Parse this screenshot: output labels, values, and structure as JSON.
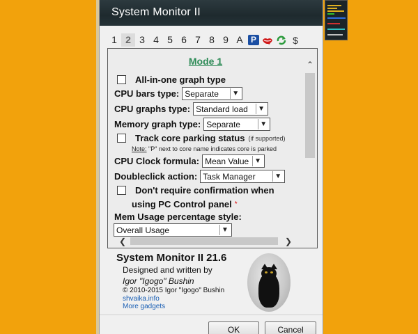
{
  "window": {
    "title": "System Monitor II"
  },
  "tabs": [
    "1",
    "2",
    "3",
    "4",
    "5",
    "6",
    "7",
    "8",
    "9",
    "A"
  ],
  "tab_icons": {
    "p_label": "P",
    "dollar_label": "$"
  },
  "panel": {
    "mode_title": "Mode 1",
    "all_in_one_label": "All-in-one graph type",
    "cpu_bars_label": "CPU bars type:",
    "cpu_bars_value": "Separate",
    "cpu_graphs_label": "CPU graphs type:",
    "cpu_graphs_value": "Standard load",
    "memory_graph_label": "Memory graph type:",
    "memory_graph_value": "Separate",
    "track_core_label": "Track core parking status",
    "track_core_hint": "(if supported)",
    "note_label": "Note:",
    "note_text": " \"P\" next to core name indicates core is parked",
    "cpu_clock_label": "CPU Clock formula:",
    "cpu_clock_value": "Mean Value",
    "doubleclick_label": "Doubleclick action:",
    "doubleclick_value": "Task Manager",
    "confirm_label": "Don't require confirmation when",
    "confirm_label2": "using PC Control panel",
    "asterisk": "*",
    "mem_usage_label": "Mem Usage percentage style:",
    "mem_usage_value": "Overall Usage"
  },
  "about": {
    "title": "System Monitor II 21.6",
    "designed": "Designed and written by",
    "author": "Igor \"Igogo\" Bushin",
    "copyright": "© 2010-2015 Igor \"Igogo\" Bushin",
    "link_site": "shvaika.info",
    "link_more": "More gadgets"
  },
  "buttons": {
    "ok": "OK",
    "cancel": "Cancel"
  },
  "colors": {
    "desktop": "#F2A20C",
    "accent_green": "#2e8b57",
    "link_blue": "#1a5fb4"
  }
}
